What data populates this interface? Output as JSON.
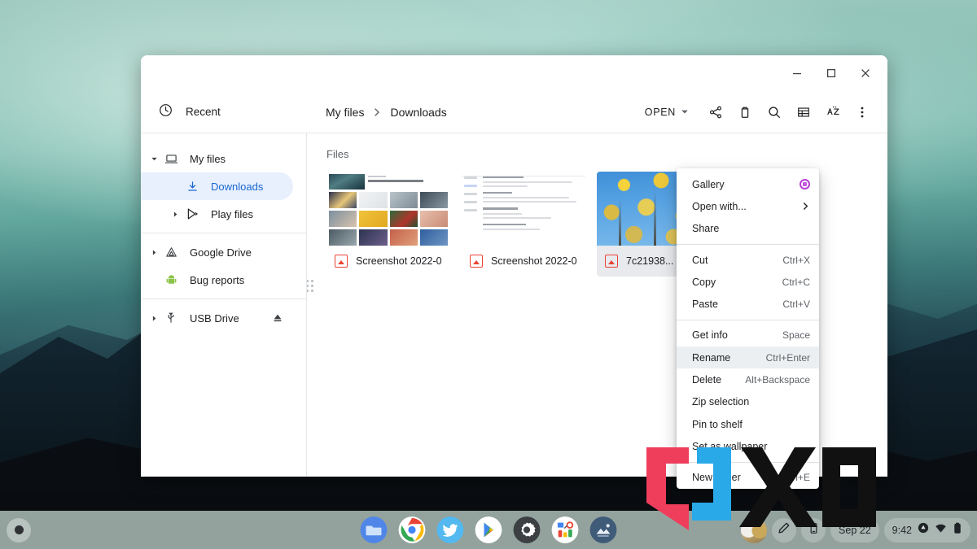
{
  "desktop": {
    "wallpaper_description": "misty teal mountain landscape",
    "wallpaper_colors": [
      "#9ec9bf",
      "#3f7d7c",
      "#12222c"
    ]
  },
  "window": {
    "controls": {
      "minimize": "minimize-window",
      "maximize": "maximize-window",
      "close": "close-window"
    }
  },
  "breadcrumb": {
    "root": "My files",
    "separator": "›",
    "current": "Downloads"
  },
  "toolbar": {
    "open_label": "OPEN",
    "share_label": "Share",
    "delete_label": "Delete",
    "search_label": "Search",
    "list_view_label": "List view",
    "sort_label": "A-Z sort",
    "more_label": "More options"
  },
  "sidebar": {
    "recent": {
      "label": "Recent",
      "icon": "clock-icon"
    },
    "groups": [
      {
        "items": [
          {
            "label": "My files",
            "icon": "computer-icon",
            "twisty": "expanded",
            "indent": false,
            "selected": false
          },
          {
            "label": "Downloads",
            "icon": "download-icon",
            "twisty": "none",
            "indent": true,
            "selected": true
          },
          {
            "label": "Play files",
            "icon": "play-store-icon",
            "twisty": "collapsed",
            "indent": true,
            "selected": false
          }
        ]
      },
      {
        "items": [
          {
            "label": "Google Drive",
            "icon": "drive-icon",
            "twisty": "collapsed",
            "indent": false,
            "selected": false
          },
          {
            "label": "Bug reports",
            "icon": "android-icon",
            "twisty": "none",
            "indent": false,
            "selected": false
          }
        ]
      },
      {
        "items": [
          {
            "label": "USB Drive",
            "icon": "usb-icon",
            "twisty": "collapsed",
            "indent": false,
            "selected": false,
            "eject": "eject-icon"
          }
        ]
      }
    ]
  },
  "content": {
    "heading": "Files",
    "files": [
      {
        "name": "Screenshot 2022-0...",
        "type_icon": "image-file-icon",
        "thumb": "gallery-grid-screenshot",
        "selected": false
      },
      {
        "name": "Screenshot 2022-0...",
        "type_icon": "image-file-icon",
        "thumb": "settings-page-screenshot",
        "selected": false
      },
      {
        "name": "7c21938...",
        "type_icon": "image-file-icon",
        "thumb": "yellow-autumn-trees-photo",
        "selected": true
      }
    ]
  },
  "context_menu": {
    "groups": [
      {
        "items": [
          {
            "label": "Gallery",
            "accel": "",
            "trailing": "gallery-app-icon",
            "highlight": false
          },
          {
            "label": "Open with...",
            "accel": "",
            "trailing": "submenu-arrow-icon",
            "highlight": false
          },
          {
            "label": "Share",
            "accel": "",
            "trailing": "",
            "highlight": false
          }
        ]
      },
      {
        "items": [
          {
            "label": "Cut",
            "accel": "Ctrl+X",
            "trailing": "",
            "highlight": false
          },
          {
            "label": "Copy",
            "accel": "Ctrl+C",
            "trailing": "",
            "highlight": false
          },
          {
            "label": "Paste",
            "accel": "Ctrl+V",
            "trailing": "",
            "highlight": false
          }
        ]
      },
      {
        "items": [
          {
            "label": "Get info",
            "accel": "Space",
            "trailing": "",
            "highlight": false
          },
          {
            "label": "Rename",
            "accel": "Ctrl+Enter",
            "trailing": "",
            "highlight": true
          },
          {
            "label": "Delete",
            "accel": "Alt+Backspace",
            "trailing": "",
            "highlight": false
          },
          {
            "label": "Zip selection",
            "accel": "",
            "trailing": "",
            "highlight": false
          },
          {
            "label": "Pin to shelf",
            "accel": "",
            "trailing": "",
            "highlight": false
          },
          {
            "label": "Set as wallpaper",
            "accel": "",
            "trailing": "",
            "highlight": false
          }
        ]
      },
      {
        "items": [
          {
            "label": "New folder",
            "accel": "Ctrl+E",
            "trailing": "",
            "highlight": false
          }
        ]
      }
    ]
  },
  "watermark": {
    "text": "XDA"
  },
  "shelf": {
    "launcher_label": "Launcher",
    "apps": [
      {
        "name": "Files",
        "icon": "files-app-icon",
        "running": true
      },
      {
        "name": "Chrome",
        "icon": "chrome-icon",
        "running": false
      },
      {
        "name": "Twitter",
        "icon": "twitter-icon",
        "running": false
      },
      {
        "name": "Play Store",
        "icon": "play-store-icon",
        "running": false
      },
      {
        "name": "Settings",
        "icon": "settings-gear-icon",
        "running": true
      },
      {
        "name": "Office",
        "icon": "office-suite-icon",
        "running": false
      },
      {
        "name": "Gallery",
        "icon": "gallery-app-icon",
        "running": true
      }
    ],
    "status": {
      "avatar": "user-avatar",
      "stylus": "stylus-icon",
      "phone_hub": "phone-icon",
      "date": "Sep 22",
      "time": "9:42",
      "notification": "notification-icon",
      "wifi": "wifi-icon",
      "battery": "battery-icon"
    }
  }
}
